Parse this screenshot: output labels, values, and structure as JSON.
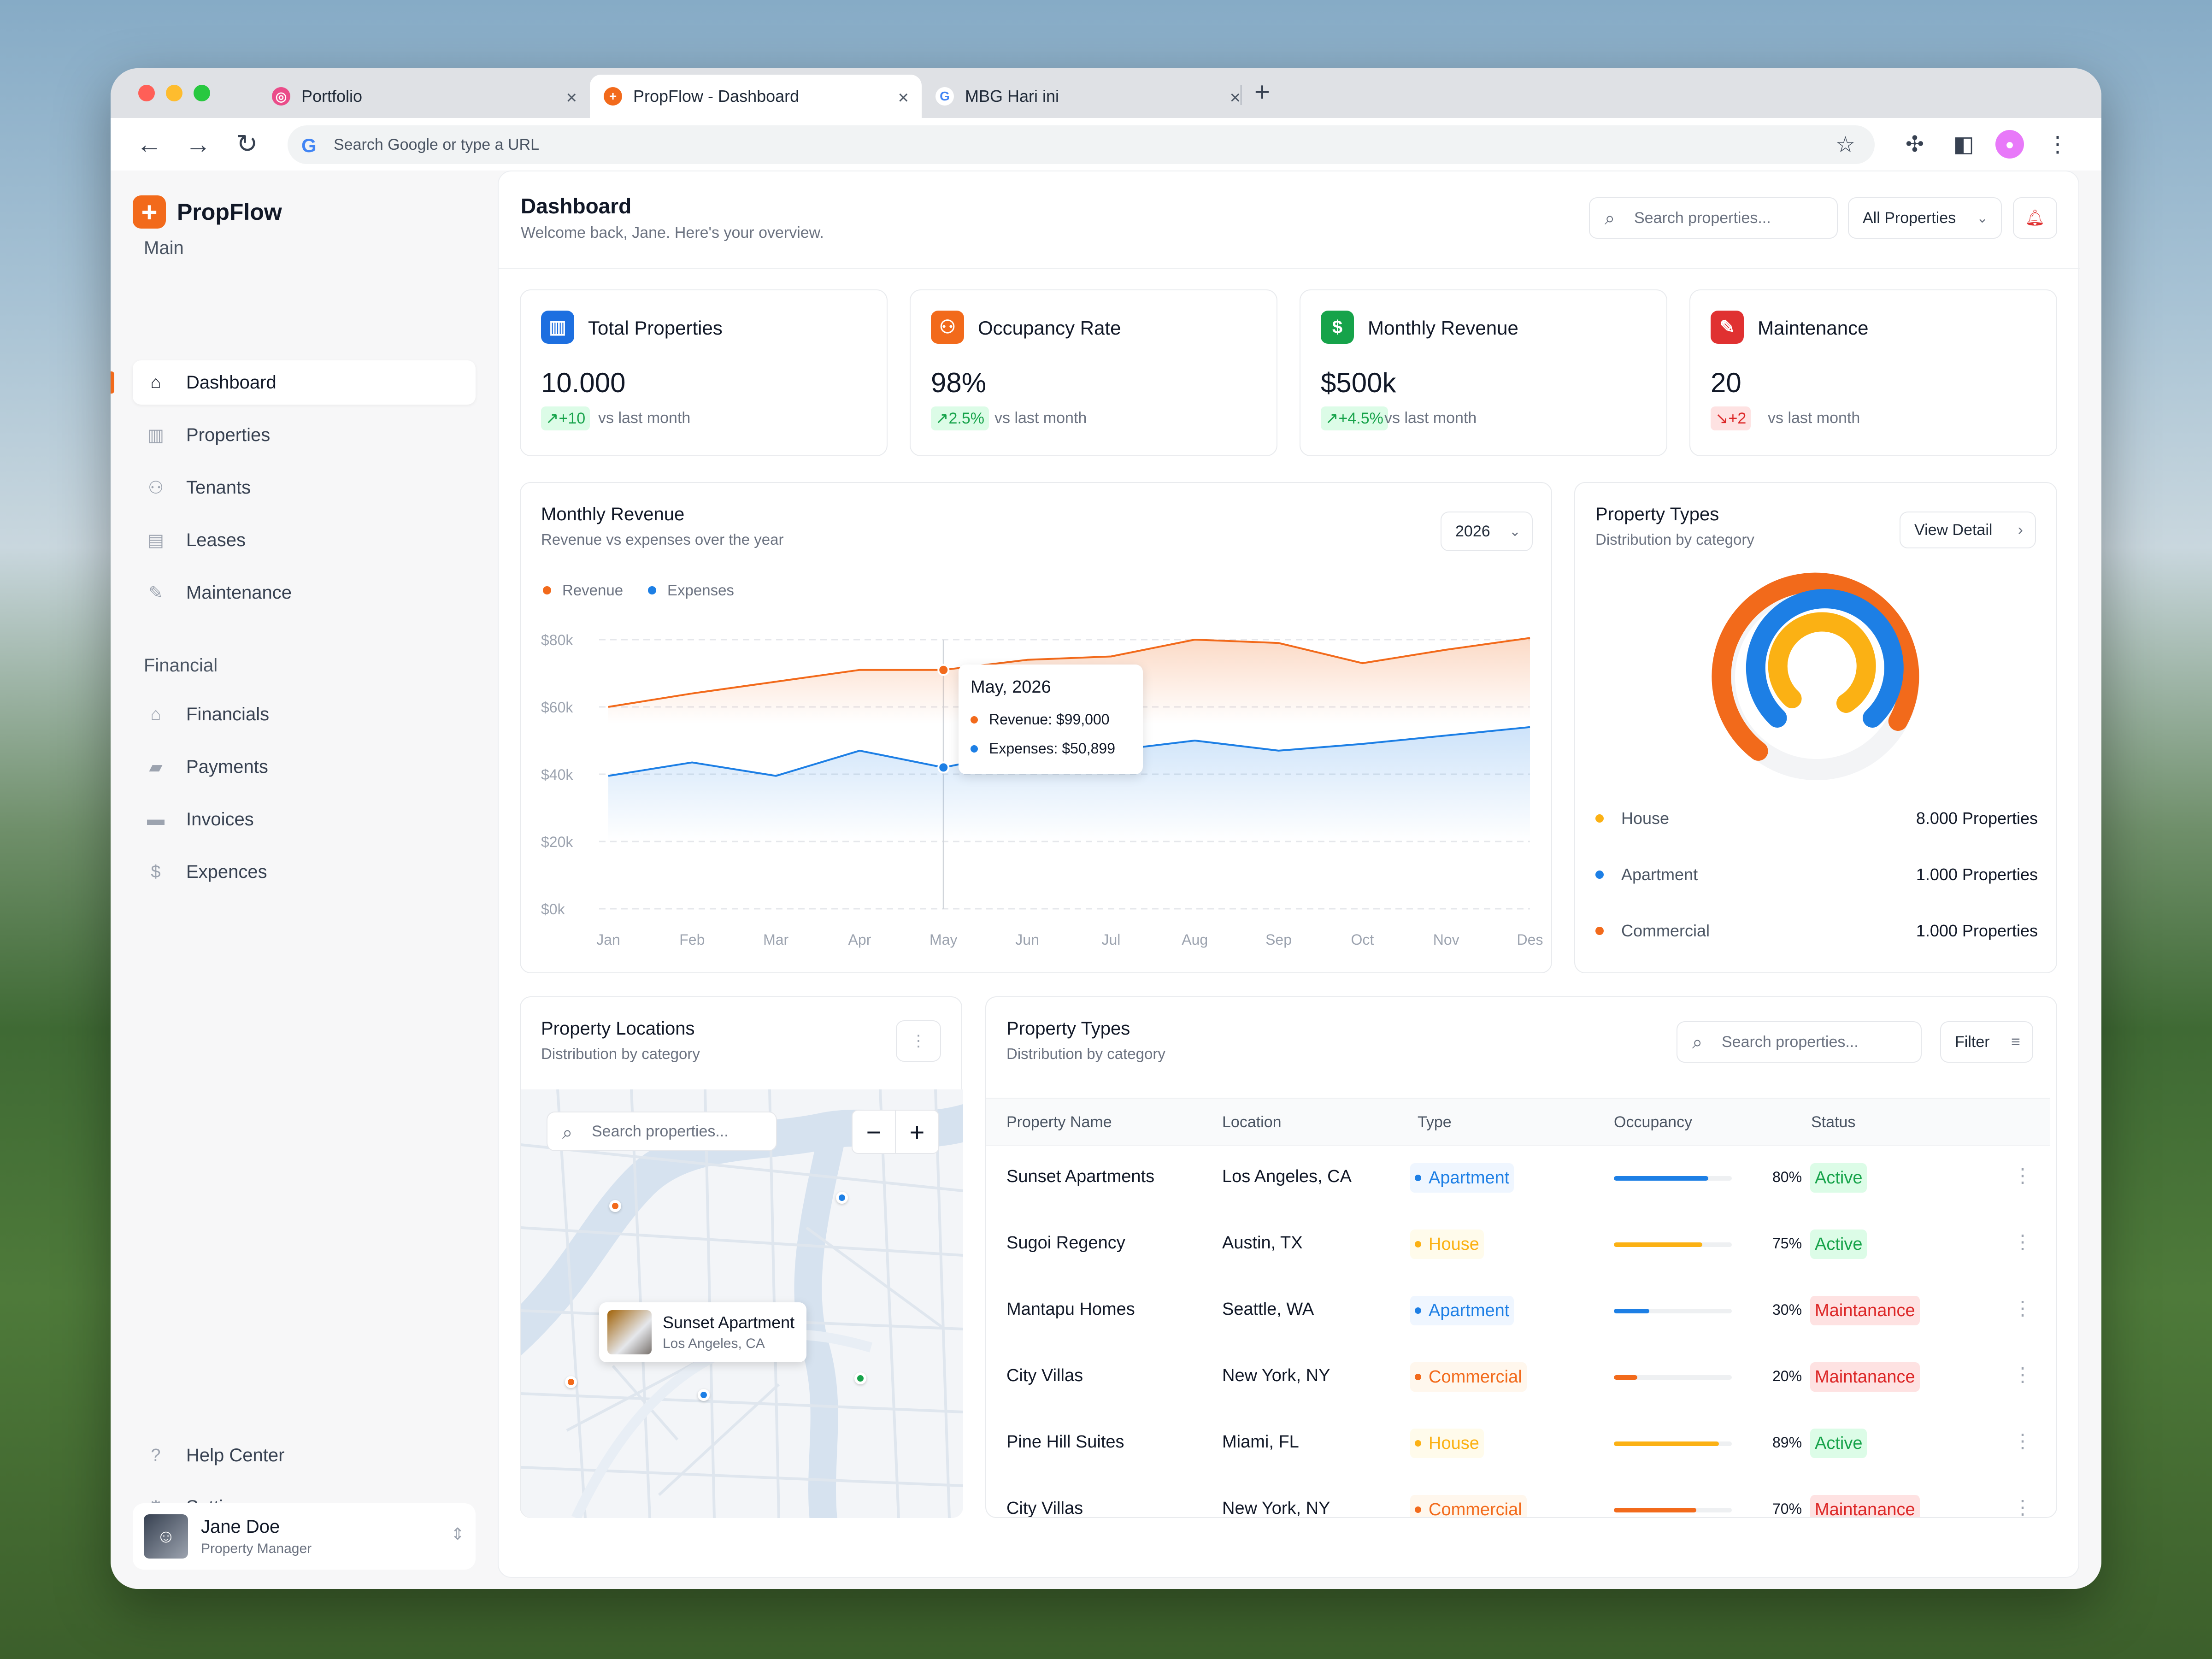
{
  "browser": {
    "tabs": [
      {
        "label": "Portfolio",
        "favicon": "dribbble-icon"
      },
      {
        "label": "PropFlow - Dashboard",
        "favicon": "propflow-icon"
      },
      {
        "label": "MBG Hari ini",
        "favicon": "google-icon"
      }
    ],
    "address_placeholder": "Search Google or type a URL"
  },
  "app": {
    "name": "PropFlow",
    "accent": "#f26a1b"
  },
  "sidebar": {
    "main_label": "Main",
    "main_items": [
      {
        "label": "Dashboard",
        "icon": "home-icon"
      },
      {
        "label": "Properties",
        "icon": "building-icon"
      },
      {
        "label": "Tenants",
        "icon": "users-icon"
      },
      {
        "label": "Leases",
        "icon": "document-icon"
      },
      {
        "label": "Maintenance",
        "icon": "wrench-icon"
      }
    ],
    "financial_label": "Financial",
    "financial_items": [
      {
        "label": "Financials",
        "icon": "bank-icon"
      },
      {
        "label": "Payments",
        "icon": "wallet-icon"
      },
      {
        "label": "Invoices",
        "icon": "invoice-icon"
      },
      {
        "label": "Expences",
        "icon": "dollar-icon"
      }
    ],
    "bottom_items": [
      {
        "label": "Help Center",
        "icon": "help-icon"
      },
      {
        "label": "Settings",
        "icon": "gear-icon"
      }
    ],
    "user": {
      "name": "Jane Doe",
      "role": "Property Manager"
    }
  },
  "header": {
    "title": "Dashboard",
    "subtitle": "Welcome back, Jane. Here's your overview.",
    "search_placeholder": "Search properties...",
    "filter_value": "All Properties"
  },
  "stats": [
    {
      "label": "Total Properties",
      "value": "10.000",
      "delta": "+10",
      "direction": "up",
      "vs": "vs last month",
      "color": "#1d6fe0"
    },
    {
      "label": "Occupancy Rate",
      "value": "98%",
      "delta": "2.5%",
      "direction": "up",
      "vs": "vs last month",
      "color": "#f26a1b"
    },
    {
      "label": "Monthly Revenue",
      "value": "$500k",
      "delta": "+4.5%",
      "direction": "up",
      "vs": "vs last month",
      "color": "#16a34a"
    },
    {
      "label": "Maintenance",
      "value": "20",
      "delta": "+2",
      "direction": "down",
      "vs": "vs last month",
      "color": "#e03131"
    }
  ],
  "revenue_card": {
    "title": "Monthly Revenue",
    "subtitle": "Revenue vs expenses over the year",
    "year": "2026",
    "tooltip": {
      "title": "May, 2026",
      "revenue": "Revenue: $99,000",
      "expenses": "Expenses: $50,899"
    }
  },
  "chart_data": {
    "type": "area",
    "categories": [
      "Jan",
      "Feb",
      "Mar",
      "Apr",
      "May",
      "Jun",
      "Jul",
      "Aug",
      "Sep",
      "Oct",
      "Nov",
      "Des"
    ],
    "series": [
      {
        "name": "Revenue",
        "color": "#f26a1b",
        "values": [
          60000,
          64000,
          67500,
          71000,
          71000,
          74000,
          75000,
          80000,
          79000,
          73000,
          77000,
          80500
        ]
      },
      {
        "name": "Expenses",
        "color": "#1d7fe5",
        "values": [
          39500,
          43500,
          39500,
          47000,
          42000,
          47000,
          47000,
          50000,
          47000,
          49000,
          51500,
          54000
        ]
      }
    ],
    "yticks": [
      "$80k",
      "$60k",
      "$40k",
      "$20k",
      "$0k"
    ],
    "ylim": [
      0,
      80000
    ],
    "grid": true,
    "legend": "top-left"
  },
  "types_card": {
    "title": "Property Types",
    "subtitle": "Distribution by category",
    "button": "View Detail",
    "items": [
      {
        "label": "House",
        "value": "8.000 Properties",
        "color": "#fbb114"
      },
      {
        "label": "Apartment",
        "value": "1.000 Properties",
        "color": "#1d7fe5"
      },
      {
        "label": "Commercial",
        "value": "1.000 Properties",
        "color": "#f26a1b"
      }
    ]
  },
  "locations_card": {
    "title": "Property Locations",
    "subtitle": "Distribution by category",
    "search_placeholder": "Search properties...",
    "popup": {
      "name": "Sunset Apartment",
      "location": "Los Angeles, CA"
    }
  },
  "table_card": {
    "title": "Property Types",
    "subtitle": "Distribution by category",
    "search_placeholder": "Search properties...",
    "filter": "Filter",
    "columns": [
      "Property Name",
      "Location",
      "Type",
      "Occupancy",
      "Status"
    ],
    "rows": [
      {
        "name": "Sunset Apartments",
        "location": "Los Angeles, CA",
        "type": "Apartment",
        "occupancy": 0.8,
        "occupancy_label": "80%",
        "status": "Active"
      },
      {
        "name": "Sugoi Regency",
        "location": "Austin, TX",
        "type": "House",
        "occupancy": 0.75,
        "occupancy_label": "75%",
        "status": "Active"
      },
      {
        "name": "Mantapu Homes",
        "location": "Seattle, WA",
        "type": "Apartment",
        "occupancy": 0.3,
        "occupancy_label": "30%",
        "status": "Maintanance"
      },
      {
        "name": "City Villas",
        "location": "New York, NY",
        "type": "Commercial",
        "occupancy": 0.2,
        "occupancy_label": "20%",
        "status": "Maintanance"
      },
      {
        "name": "Pine Hill Suites",
        "location": "Miami, FL",
        "type": "House",
        "occupancy": 0.89,
        "occupancy_label": "89%",
        "status": "Active"
      },
      {
        "name": "City Villas",
        "location": "New York, NY",
        "type": "Commercial",
        "occupancy": 0.7,
        "occupancy_label": "70%",
        "status": "Maintanance"
      }
    ]
  }
}
